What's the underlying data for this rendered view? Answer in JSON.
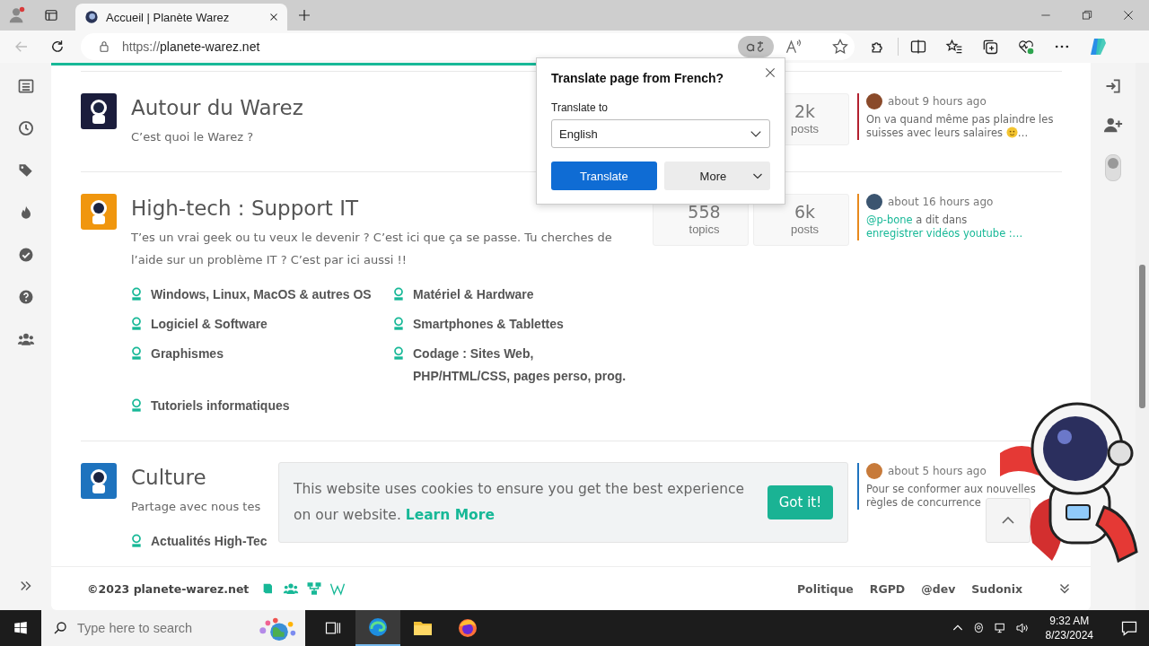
{
  "browser": {
    "tab_title": "Accueil | Planète Warez",
    "url_scheme": "https://",
    "url_host": "planete-warez.net"
  },
  "categories": [
    {
      "title": "Autour du Warez",
      "description": "C’est quoi le Warez ?",
      "color": "#1b1d3c",
      "stats": [
        {
          "value": "2k",
          "label": "posts"
        }
      ],
      "last_post": {
        "time": "about 9 hours ago",
        "color": "#b3202f",
        "parts": [
          {
            "kind": "text",
            "text": "On va quand même pas plaindre les suisses avec leurs salaires"
          },
          {
            "kind": "emoji"
          },
          {
            "kind": "text",
            "text": "…"
          }
        ]
      }
    },
    {
      "title": "High-tech : Support IT",
      "description": "T’es un vrai geek ou tu veux le devenir ? C’est ici que ça se passe. Tu cherches de l’aide sur un problème IT ? C’est par ici aussi !!",
      "color": "#f0960e",
      "stats": [
        {
          "value": "558",
          "label": "topics"
        },
        {
          "value": "6k",
          "label": "posts"
        }
      ],
      "subforums": [
        {
          "label": "Windows, Linux, MacOS & autres OS"
        },
        {
          "label": "Matériel & Hardware"
        },
        {
          "label": "Logiciel & Software"
        },
        {
          "label": "Smartphones & Tablettes"
        },
        {
          "label": "Graphismes"
        },
        {
          "label": "Codage : Sites Web, PHP/HTML/CSS, pages perso, prog."
        },
        {
          "label": "Tutoriels informatiques"
        }
      ],
      "last_post": {
        "time": "about 16 hours ago",
        "color": "#e8891c",
        "parts": [
          {
            "kind": "link",
            "text": "@p-bone"
          },
          {
            "kind": "text",
            "text": "a dit dans"
          },
          {
            "kind": "link",
            "text": "enregistrer vidéos youtube :…"
          }
        ]
      }
    },
    {
      "title": "Culture",
      "description": "Partage avec nous tes",
      "color": "#1e73be",
      "subforums": [
        {
          "label": "Actualités High-Tec"
        }
      ],
      "last_post": {
        "time": "about 5 hours ago",
        "color": "#1e73be",
        "parts": [
          {
            "kind": "text",
            "text": "Pour se conformer aux nouvelles règles de concurrence"
          }
        ]
      }
    }
  ],
  "dark_mode_switch": {
    "on": false
  },
  "footer": {
    "copyright": "©2023 planete-warez.net",
    "links": [
      "Politique",
      "RGPD",
      "@dev",
      "Sudonix"
    ]
  },
  "translate_popup": {
    "title": "Translate page from French?",
    "label": "Translate to",
    "language": "English",
    "primary_button": "Translate",
    "secondary_button": "More"
  },
  "cookie_banner": {
    "text": "This website uses cookies to ensure you get the best experience on our website.",
    "link": "Learn More",
    "button": "Got it!"
  },
  "taskbar": {
    "search_placeholder": "Type here to search",
    "time": "9:32 AM",
    "date": "8/23/2024"
  }
}
